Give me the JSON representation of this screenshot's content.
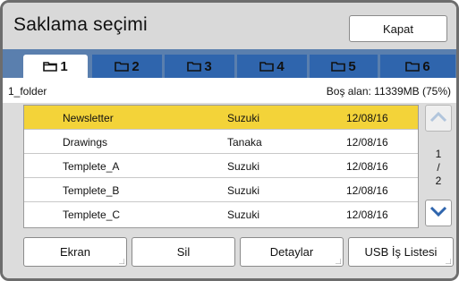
{
  "window": {
    "title": "Saklama seçimi",
    "close_label": "Kapat"
  },
  "tabs": [
    {
      "label": "1",
      "icon": "folder-icon",
      "active": true
    },
    {
      "label": "2",
      "icon": "folder-icon",
      "active": false
    },
    {
      "label": "3",
      "icon": "folder-icon",
      "active": false
    },
    {
      "label": "4",
      "icon": "folder-icon",
      "active": false
    },
    {
      "label": "5",
      "icon": "folder-icon",
      "active": false
    },
    {
      "label": "6",
      "icon": "folder-icon",
      "active": false
    }
  ],
  "folder": {
    "name": "1_folder",
    "free_space": "Boş alan: 11339MB (75%)"
  },
  "files": [
    {
      "name": "Newsletter",
      "owner": "Suzuki",
      "date": "12/08/16",
      "selected": true
    },
    {
      "name": "Drawings",
      "owner": "Tanaka",
      "date": "12/08/16",
      "selected": false
    },
    {
      "name": "Templete_A",
      "owner": "Suzuki",
      "date": "12/08/16",
      "selected": false
    },
    {
      "name": "Templete_B",
      "owner": "Suzuki",
      "date": "12/08/16",
      "selected": false
    },
    {
      "name": "Templete_C",
      "owner": "Suzuki",
      "date": "12/08/16",
      "selected": false
    }
  ],
  "pagination": {
    "current": "1",
    "separator": "/",
    "total": "2"
  },
  "buttons": {
    "screen": "Ekran",
    "delete": "Sil",
    "details": "Detaylar",
    "usb_list": "USB İş Listesi"
  },
  "colors": {
    "tab_active_bg": "#ffffff",
    "tab_bg": "#2f65ad",
    "tab_strip": "#5a7fae",
    "selected_row": "#f3d339",
    "scroll_arrow": "#2f65ad"
  }
}
